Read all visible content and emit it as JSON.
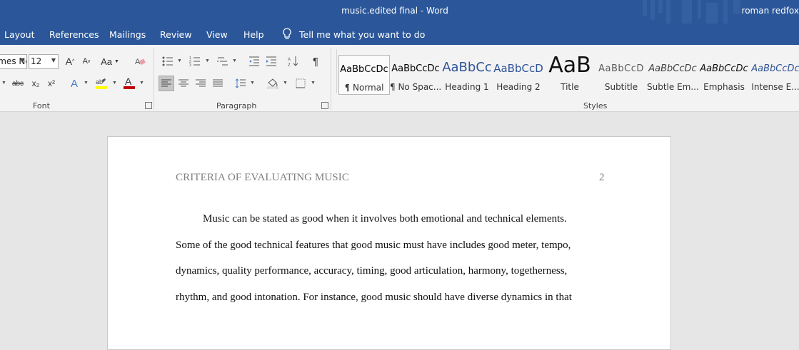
{
  "window": {
    "title": "music.edited final  -  Word",
    "user": "roman redfox"
  },
  "tabs": [
    "Layout",
    "References",
    "Mailings",
    "Review",
    "View",
    "Help"
  ],
  "tell_me": "Tell me what you want to do",
  "font": {
    "name": "Times New Roma",
    "size": "12"
  },
  "groups": {
    "font": "Font",
    "paragraph": "Paragraph",
    "styles": "Styles"
  },
  "font_buttons": {
    "case": "Aa",
    "strike": "abc",
    "sub": "x₂",
    "sup": "x²",
    "grow": "A",
    "shrink": "A",
    "font_color": "A",
    "effects": "A"
  },
  "styles": [
    {
      "preview": "AaBbCcDc",
      "label": "¶ Normal"
    },
    {
      "preview": "AaBbCcDc",
      "label": "¶ No Spac..."
    },
    {
      "preview": "AaBbCc",
      "label": "Heading 1"
    },
    {
      "preview": "AaBbCcD",
      "label": "Heading 2"
    },
    {
      "preview": "AaB",
      "label": "Title"
    },
    {
      "preview": "AaBbCcD",
      "label": "Subtitle"
    },
    {
      "preview": "AaBbCcDc",
      "label": "Subtle Em..."
    },
    {
      "preview": "AaBbCcDc",
      "label": "Emphasis"
    },
    {
      "preview": "AaBbCcDc",
      "label": "Intense E..."
    }
  ],
  "colors": {
    "ribbon_blue": "#2b579a",
    "heading_blue": "#2f5496",
    "highlight": "#ffff00",
    "font_red": "#c00000"
  },
  "document": {
    "header": "CRITERIA OF EVALUATING MUSIC",
    "page_number": "2",
    "lines": [
      "Music can be stated as good when it involves both emotional and technical elements.",
      "Some of the good technical features that good music must have includes good meter, tempo,",
      "dynamics, quality performance, accuracy, timing, good articulation, harmony, togetherness,",
      "rhythm, and good intonation. For instance, good music should have diverse dynamics in that"
    ]
  }
}
